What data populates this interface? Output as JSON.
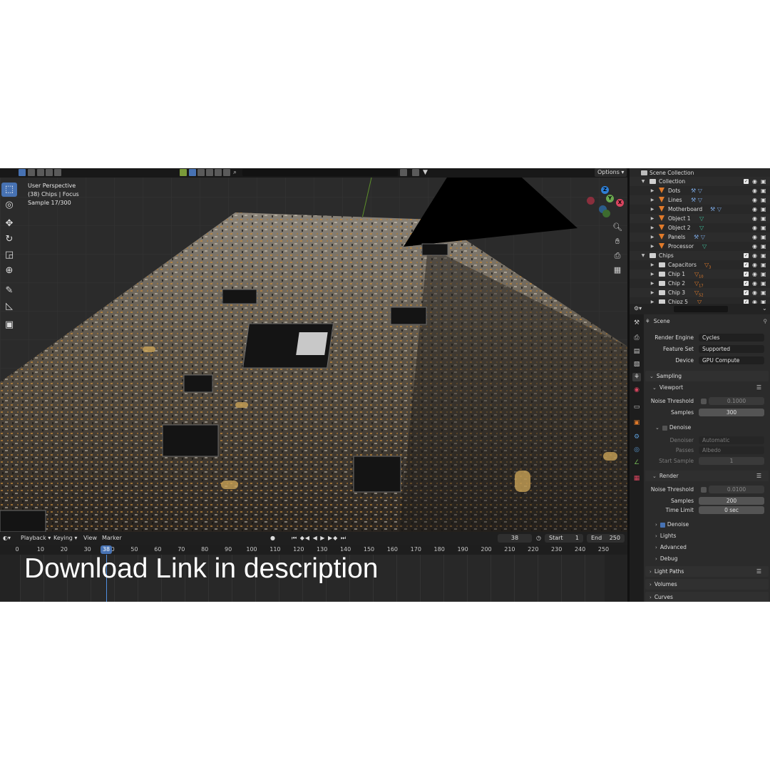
{
  "viewport": {
    "info_lines": [
      "User Perspective",
      "(38) Chips | Focus",
      "Sample 17/300"
    ],
    "options_label": "Options",
    "gizmo": {
      "z": "Z",
      "y": "Y",
      "x": "X"
    },
    "tools": [
      "select-box-icon",
      "cursor-icon",
      "move-icon",
      "rotate-icon",
      "scale-icon",
      "transform-icon",
      "annotate-icon",
      "measure-icon",
      "add-cube-icon"
    ]
  },
  "timeline": {
    "menu": {
      "playback": "Playback",
      "keying": "Keying",
      "view": "View",
      "marker": "Marker"
    },
    "current_frame": "38",
    "start_label": "Start",
    "start_value": "1",
    "end_label": "End",
    "end_value": "250",
    "ticks": [
      "0",
      "10",
      "20",
      "30",
      "40",
      "50",
      "60",
      "70",
      "80",
      "90",
      "100",
      "110",
      "120",
      "130",
      "140",
      "150",
      "160",
      "170",
      "180",
      "190",
      "200",
      "210",
      "220",
      "230",
      "240",
      "250"
    ],
    "cursor_label": "38",
    "overlay_text": "Download Link in description"
  },
  "outliner": {
    "rows": [
      {
        "label": "Scene Collection",
        "type": "scene"
      },
      {
        "label": "Collection",
        "type": "collection"
      },
      {
        "label": "Dots",
        "type": "object",
        "mods": "⚒ ▽"
      },
      {
        "label": "Lines",
        "type": "object",
        "mods": "⚒ ▽"
      },
      {
        "label": "Motherboard",
        "type": "object",
        "mods": "⚒ ▽"
      },
      {
        "label": "Object 1",
        "type": "object",
        "mods": "▽"
      },
      {
        "label": "Object 2",
        "type": "object",
        "mods": "▽"
      },
      {
        "label": "Panels",
        "type": "object",
        "mods": "⚒ ▽"
      },
      {
        "label": "Processor",
        "type": "object",
        "mods": "▽"
      },
      {
        "label": "Chips",
        "type": "collection"
      },
      {
        "label": "Capacitors",
        "type": "subcollection",
        "badge": "3"
      },
      {
        "label": "Chip 1",
        "type": "subcollection",
        "badge": "10"
      },
      {
        "label": "Chip 2",
        "type": "subcollection",
        "badge": "17"
      },
      {
        "label": "Chip 3",
        "type": "subcollection",
        "badge": "52"
      },
      {
        "label": "Chipz 5",
        "type": "subcollection",
        "badge": ""
      }
    ]
  },
  "properties": {
    "context": "Scene",
    "render_engine_label": "Render Engine",
    "render_engine": "Cycles",
    "feature_set_label": "Feature Set",
    "feature_set": "Supported",
    "device_label": "Device",
    "device": "GPU Compute",
    "sampling": "Sampling",
    "viewport": "Viewport",
    "noise_threshold_label": "Noise Threshold",
    "viewport_noise_threshold": "0.1000",
    "samples_label": "Samples",
    "viewport_samples": "300",
    "denoise": "Denoise",
    "denoiser_label": "Denoiser",
    "denoiser": "Automatic",
    "passes_label": "Passes",
    "passes": "Albedo",
    "start_sample_label": "Start Sample",
    "start_sample": "1",
    "render": "Render",
    "render_noise_threshold": "0.0100",
    "render_samples": "200",
    "time_limit_label": "Time Limit",
    "time_limit": "0 sec",
    "render_denoise": "Denoise",
    "lights": "Lights",
    "advanced": "Advanced",
    "debug": "Debug",
    "light_paths": "Light Paths",
    "volumes": "Volumes",
    "curves": "Curves"
  }
}
